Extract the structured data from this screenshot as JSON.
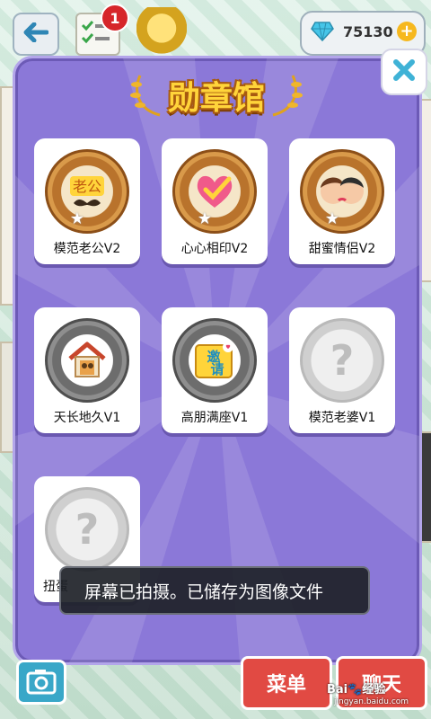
{
  "top_bar": {
    "task_badge_count": "1",
    "gem_count": "75130",
    "icons": [
      "back-arrow-icon",
      "task-list-icon",
      "trophy-icon",
      "diamond-icon",
      "plus-icon"
    ]
  },
  "modal": {
    "title": "勋章馆",
    "close_icon": "close-icon",
    "badges": [
      {
        "label": "模范老公V2",
        "state": "earned",
        "icon": "husband-mustache-icon"
      },
      {
        "label": "心心相印V2",
        "state": "earned",
        "icon": "heart-check-icon"
      },
      {
        "label": "甜蜜情侣V2",
        "state": "earned",
        "icon": "kissing-couple-icon"
      },
      {
        "label": "天长地久V1",
        "state": "earned",
        "icon": "house-couple-icon"
      },
      {
        "label": "高朋满座V1",
        "state": "earned",
        "icon": "invite-icon"
      },
      {
        "label": "模范老婆V1",
        "state": "locked",
        "icon": "question-mark-icon"
      },
      {
        "label": "扭蛋",
        "state": "locked",
        "icon": "question-mark-icon"
      }
    ]
  },
  "toast": {
    "message": "屏幕已拍摄。已储存为图像文件"
  },
  "bottom_bar": {
    "menu_label": "菜单",
    "chat_label": "聊天",
    "camera_icon": "camera-icon"
  },
  "watermark": {
    "brand": "Bai🐾经验",
    "url": "jingyan.baidu.com"
  },
  "colors": {
    "modal_bg": "#8b78d8",
    "title": "#ffd43a",
    "bronze": "#d99a4a",
    "silver": "#8e8e8e",
    "toast_bg": "#1e2228"
  }
}
